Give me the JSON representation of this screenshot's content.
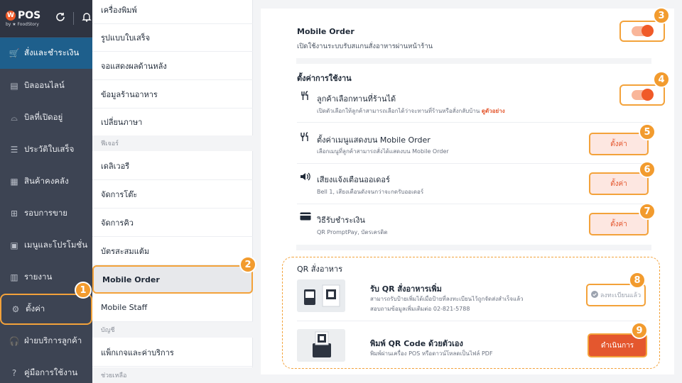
{
  "brand": {
    "logo_mark": "W",
    "logo_name": "POS",
    "logo_sub": "by ★ FoodStory"
  },
  "sidebar": {
    "items": [
      {
        "label": "สั่งและชำระเงิน",
        "icon": "cart-icon"
      },
      {
        "label": "บิลออนไลน์",
        "icon": "bill-icon"
      },
      {
        "label": "บิลที่เปิดอยู่",
        "icon": "open-bill-icon"
      },
      {
        "label": "ประวัติใบเสร็จ",
        "icon": "receipt-icon"
      },
      {
        "label": "สินค้าคงคลัง",
        "icon": "inventory-icon"
      },
      {
        "label": "รอบการขาย",
        "icon": "sales-round-icon"
      },
      {
        "label": "เมนูและโปรโมชั่น",
        "icon": "menu-icon"
      },
      {
        "label": "รายงาน",
        "icon": "report-icon"
      },
      {
        "label": "ตั้งค่า",
        "icon": "gear-icon"
      },
      {
        "label": "ฝ่ายบริการลูกค้า",
        "icon": "headset-icon"
      },
      {
        "label": "คู่มือการใช้งาน",
        "icon": "help-icon"
      }
    ]
  },
  "submenu": {
    "items": [
      "เครื่องพิมพ์",
      "รูปแบบใบเสร็จ",
      "จอแสดงผลด้านหลัง",
      "ข้อมูลร้านอาหาร",
      "เปลี่ยนภาษา",
      "ฟีเจอร์",
      "เดลิเวอรี",
      "จัดการโต๊ะ",
      "จัดการคิว",
      "บัตรสะสมแต้ม",
      "Mobile Order",
      "Mobile Staff",
      "บัญชี",
      "แพ็กเกจและค่าบริการ",
      "ช่วยเหลือ"
    ]
  },
  "main": {
    "mobile_order": {
      "title": "Mobile Order",
      "desc": "เปิดใช้งานระบบรับสแกนสั่งอาหารผ่านหน้าร้าน"
    },
    "settings_header": "ตั้งค่าการใช้งาน",
    "dine_choice": {
      "title": "ลูกค้าเลือกทานที่ร้านได้",
      "desc": "เปิดตัวเลือกให้ลูกค้าสามารถเลือกได้ว่าจะทานที่ร้านหรือสั่งกลับบ้าน",
      "link": "ดูตัวอย่าง"
    },
    "menu_display": {
      "title": "ตั้งค่าเมนูแสดงบน Mobile Order",
      "desc": "เลือกเมนูที่ลูกค้าสามารถสั่งได้แสดงบน Mobile Order",
      "button": "ตั้งค่า"
    },
    "sound": {
      "title": "เสียงแจ้งเตือนออเดอร์",
      "desc": "Bell 1, เสียงเตือนดังจนกว่าจะกดรับออเดอร์",
      "button": "ตั้งค่า"
    },
    "payment": {
      "title": "วิธีรับชำระเงิน",
      "desc": "QR PromptPay, บัตรเครดิต",
      "button": "ตั้งค่า"
    },
    "qr": {
      "header": "QR สั่งอาหาร",
      "receive": {
        "title": "รับ QR สั่งอาหารเพิ่ม",
        "desc1": "สามารถรับป้ายเพิ่มได้เมื่อป้ายที่ลงทะเบียนไว้ถูกจัดส่งสำเร็จแล้ว",
        "desc2": "สอบถามข้อมูลเพิ่มเติมต่อ 02-821-5788",
        "status": "ลงทะเบียนแล้ว"
      },
      "print": {
        "title": "พิมพ์ QR Code ด้วยตัวเอง",
        "desc": "พิมพ์ผ่านเครื่อง POS หรือดาวน์โหลดเป็นไฟล์ PDF",
        "button": "ดำเนินการ"
      }
    }
  },
  "badges": [
    "1",
    "2",
    "3",
    "4",
    "5",
    "6",
    "7",
    "8",
    "9"
  ],
  "colors": {
    "accent": "#f05a28",
    "highlight": "#f3a23a",
    "sidebar": "#3d4453",
    "active": "#1e5f8c"
  }
}
